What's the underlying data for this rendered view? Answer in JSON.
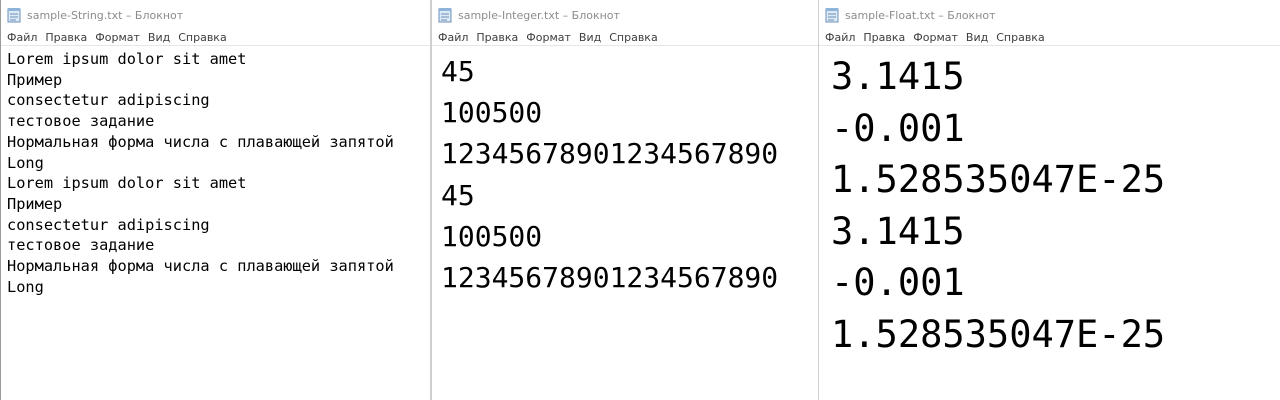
{
  "menu": [
    "Файл",
    "Правка",
    "Формат",
    "Вид",
    "Справка"
  ],
  "windows": [
    {
      "title": "sample-String.txt – Блокнот",
      "lines": [
        "Lorem ipsum dolor sit amet",
        "Пример",
        "consectetur adipiscing",
        "тестовое задание",
        "Нормальная форма числа с плавающей запятой",
        "Long",
        "Lorem ipsum dolor sit amet",
        "Пример",
        "consectetur adipiscing",
        "тестовое задание",
        "Нормальная форма числа с плавающей запятой",
        "Long"
      ]
    },
    {
      "title": "sample-Integer.txt – Блокнот",
      "lines": [
        "45",
        "100500",
        "12345678901234567890",
        "45",
        "100500",
        "12345678901234567890"
      ]
    },
    {
      "title": "sample-Float.txt – Блокнот",
      "lines": [
        "3.1415",
        "-0.001",
        "1.528535047E-25",
        "3.1415",
        "-0.001",
        "1.528535047E-25"
      ]
    }
  ],
  "icon": "notepad-icon"
}
